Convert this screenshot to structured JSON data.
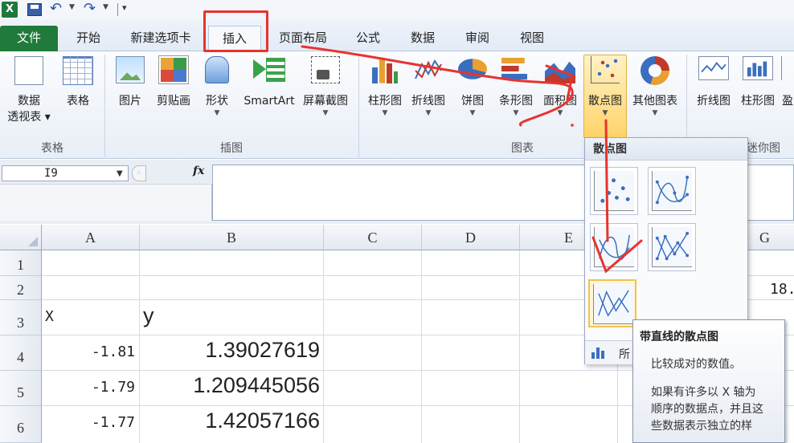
{
  "qat": {
    "app_icon": "excel-logo-icon",
    "app_letter": "X",
    "icons": [
      "save-icon",
      "undo-icon",
      "redo-icon",
      "customize-quick-access-icon"
    ]
  },
  "tabs": [
    "文件",
    "开始",
    "新建选项卡",
    "插入",
    "页面布局",
    "公式",
    "数据",
    "审阅",
    "视图"
  ],
  "active_tab": "插入",
  "ribbon": {
    "tables": {
      "pivot_line1": "数据",
      "pivot_line2": "透视表",
      "table": "表格",
      "group": "表格"
    },
    "illustrations": {
      "picture": "图片",
      "clipart": "剪贴画",
      "shapes": "形状",
      "smartart": "SmartArt",
      "screenshot": "屏幕截图",
      "group": "插图"
    },
    "charts": {
      "column": "柱形图",
      "line": "折线图",
      "pie": "饼图",
      "bar": "条形图",
      "area": "面积图",
      "scatter": "散点图",
      "other": "其他图表",
      "group": "图表"
    },
    "sparklines": {
      "line": "折线图",
      "column": "柱形图",
      "winloss": "盈",
      "group": "迷你图"
    }
  },
  "formula_bar": {
    "name_box": "I9",
    "fx_label": "fx",
    "formula": ""
  },
  "grid": {
    "columns": [
      "A",
      "B",
      "C",
      "D",
      "E",
      "F",
      "G"
    ],
    "rows": [
      "1",
      "2",
      "3",
      "4",
      "5",
      "6"
    ],
    "cells": {
      "A3": "X",
      "B3": "y",
      "A4": "-1.81",
      "B4": "1.39027619",
      "A5": "-1.79",
      "B5": "1.209445056",
      "A6": "-1.77",
      "B6": "1.42057166",
      "G2": "18."
    }
  },
  "scatter_gallery": {
    "title": "散点图",
    "thumbnails": [
      "scatter-markers-only",
      "scatter-smooth-lines-markers",
      "scatter-smooth-lines",
      "scatter-straight-lines-markers",
      "scatter-straight-lines"
    ],
    "selected": "scatter-straight-lines",
    "footer": "所"
  },
  "tooltip": {
    "title": "带直线的散点图",
    "line1": "比较成对的数值。",
    "line2a": "如果有许多以 X 轴为",
    "line2b": "顺序的数据点，并且这",
    "line2c": "些数据表示独立的样"
  },
  "colors": {
    "file_tab": "#207a3a",
    "annotation": "#e8332e",
    "highlight": "#ffd36a"
  }
}
